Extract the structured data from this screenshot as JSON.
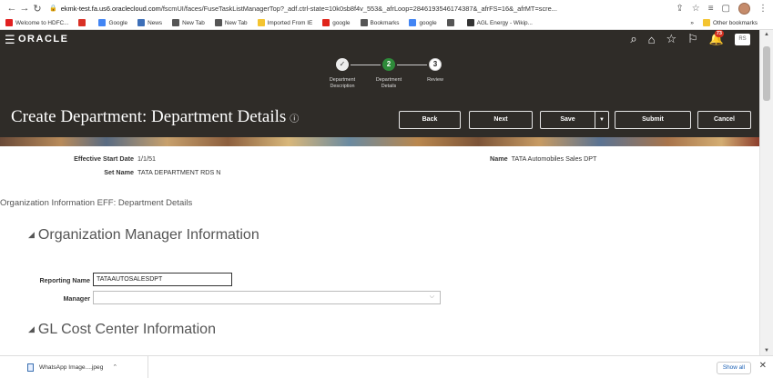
{
  "browser": {
    "url_host": "ekmk-test.fa.us6.oraclecloud.com",
    "url_path": "/fscmUI/faces/FuseTaskListManagerTop?_adf.ctrl-state=10k0sb8f4v_553&_afrLoop=2846193546174387&_afrFS=16&_afrMT=scre...",
    "bookmarks": [
      {
        "label": "Welcome to HDFC...",
        "icon": "hdfc-icon",
        "color": "#e12020"
      },
      {
        "label": "",
        "icon": "gmail-icon",
        "color": "#d93025"
      },
      {
        "label": "Google",
        "icon": "google-icon",
        "color": "#4285f4"
      },
      {
        "label": "News",
        "icon": "news-icon",
        "color": "#3d6fb8"
      },
      {
        "label": "New Tab",
        "icon": "globe-icon",
        "color": "#555555"
      },
      {
        "label": "New Tab",
        "icon": "globe-icon",
        "color": "#555555"
      },
      {
        "label": "Imported From IE",
        "icon": "folder-icon",
        "color": "#f4c430"
      },
      {
        "label": "google",
        "icon": "opera-icon",
        "color": "#e0241a"
      },
      {
        "label": "Bookmarks",
        "icon": "star-icon",
        "color": "#555555"
      },
      {
        "label": "google",
        "icon": "google-icon",
        "color": "#4285f4"
      },
      {
        "label": "",
        "icon": "globe-icon",
        "color": "#555555"
      },
      {
        "label": "AGL Energy - Wikip...",
        "icon": "wikipedia-icon",
        "color": "#333333"
      }
    ],
    "other_bookmarks": "Other bookmarks",
    "more": "»"
  },
  "header": {
    "logo": "ORACLE",
    "notification_count": "73",
    "user_initials": "RS"
  },
  "train": {
    "stops": [
      {
        "number": "✓",
        "label_line1": "Department",
        "label_line2": "Description",
        "state": "complete"
      },
      {
        "number": "2",
        "label_line1": "Department",
        "label_line2": "Details",
        "state": "current"
      },
      {
        "number": "3",
        "label_line1": "Review",
        "label_line2": "",
        "state": "pending"
      }
    ]
  },
  "page": {
    "title": "Create Department: Department Details",
    "buttons": {
      "back": "Back",
      "next": "Next",
      "save": "Save",
      "submit": "Submit",
      "cancel": "Cancel"
    }
  },
  "details": {
    "effective_start_date_label": "Effective Start Date",
    "effective_start_date": "1/1/51",
    "set_name_label": "Set Name",
    "set_name": "TATA DEPARTMENT RDS N",
    "name_label": "Name",
    "name": "TATA Automobiles Sales DPT"
  },
  "org_info": {
    "title": "Organization Information EFF: Department Details",
    "manager_section": "Organization Manager Information",
    "reporting_name_label": "Reporting Name",
    "reporting_name": "TATAAUTOSALESDPT",
    "manager_label": "Manager",
    "manager_value": "",
    "gl_section": "GL Cost Center Information"
  },
  "downloads": {
    "file": "WhatsApp Image....jpeg",
    "show_all": "Show all"
  },
  "colors": {
    "band": "#2f2c28",
    "train_current": "#2e8b3a",
    "notification": "#d42f1f"
  }
}
